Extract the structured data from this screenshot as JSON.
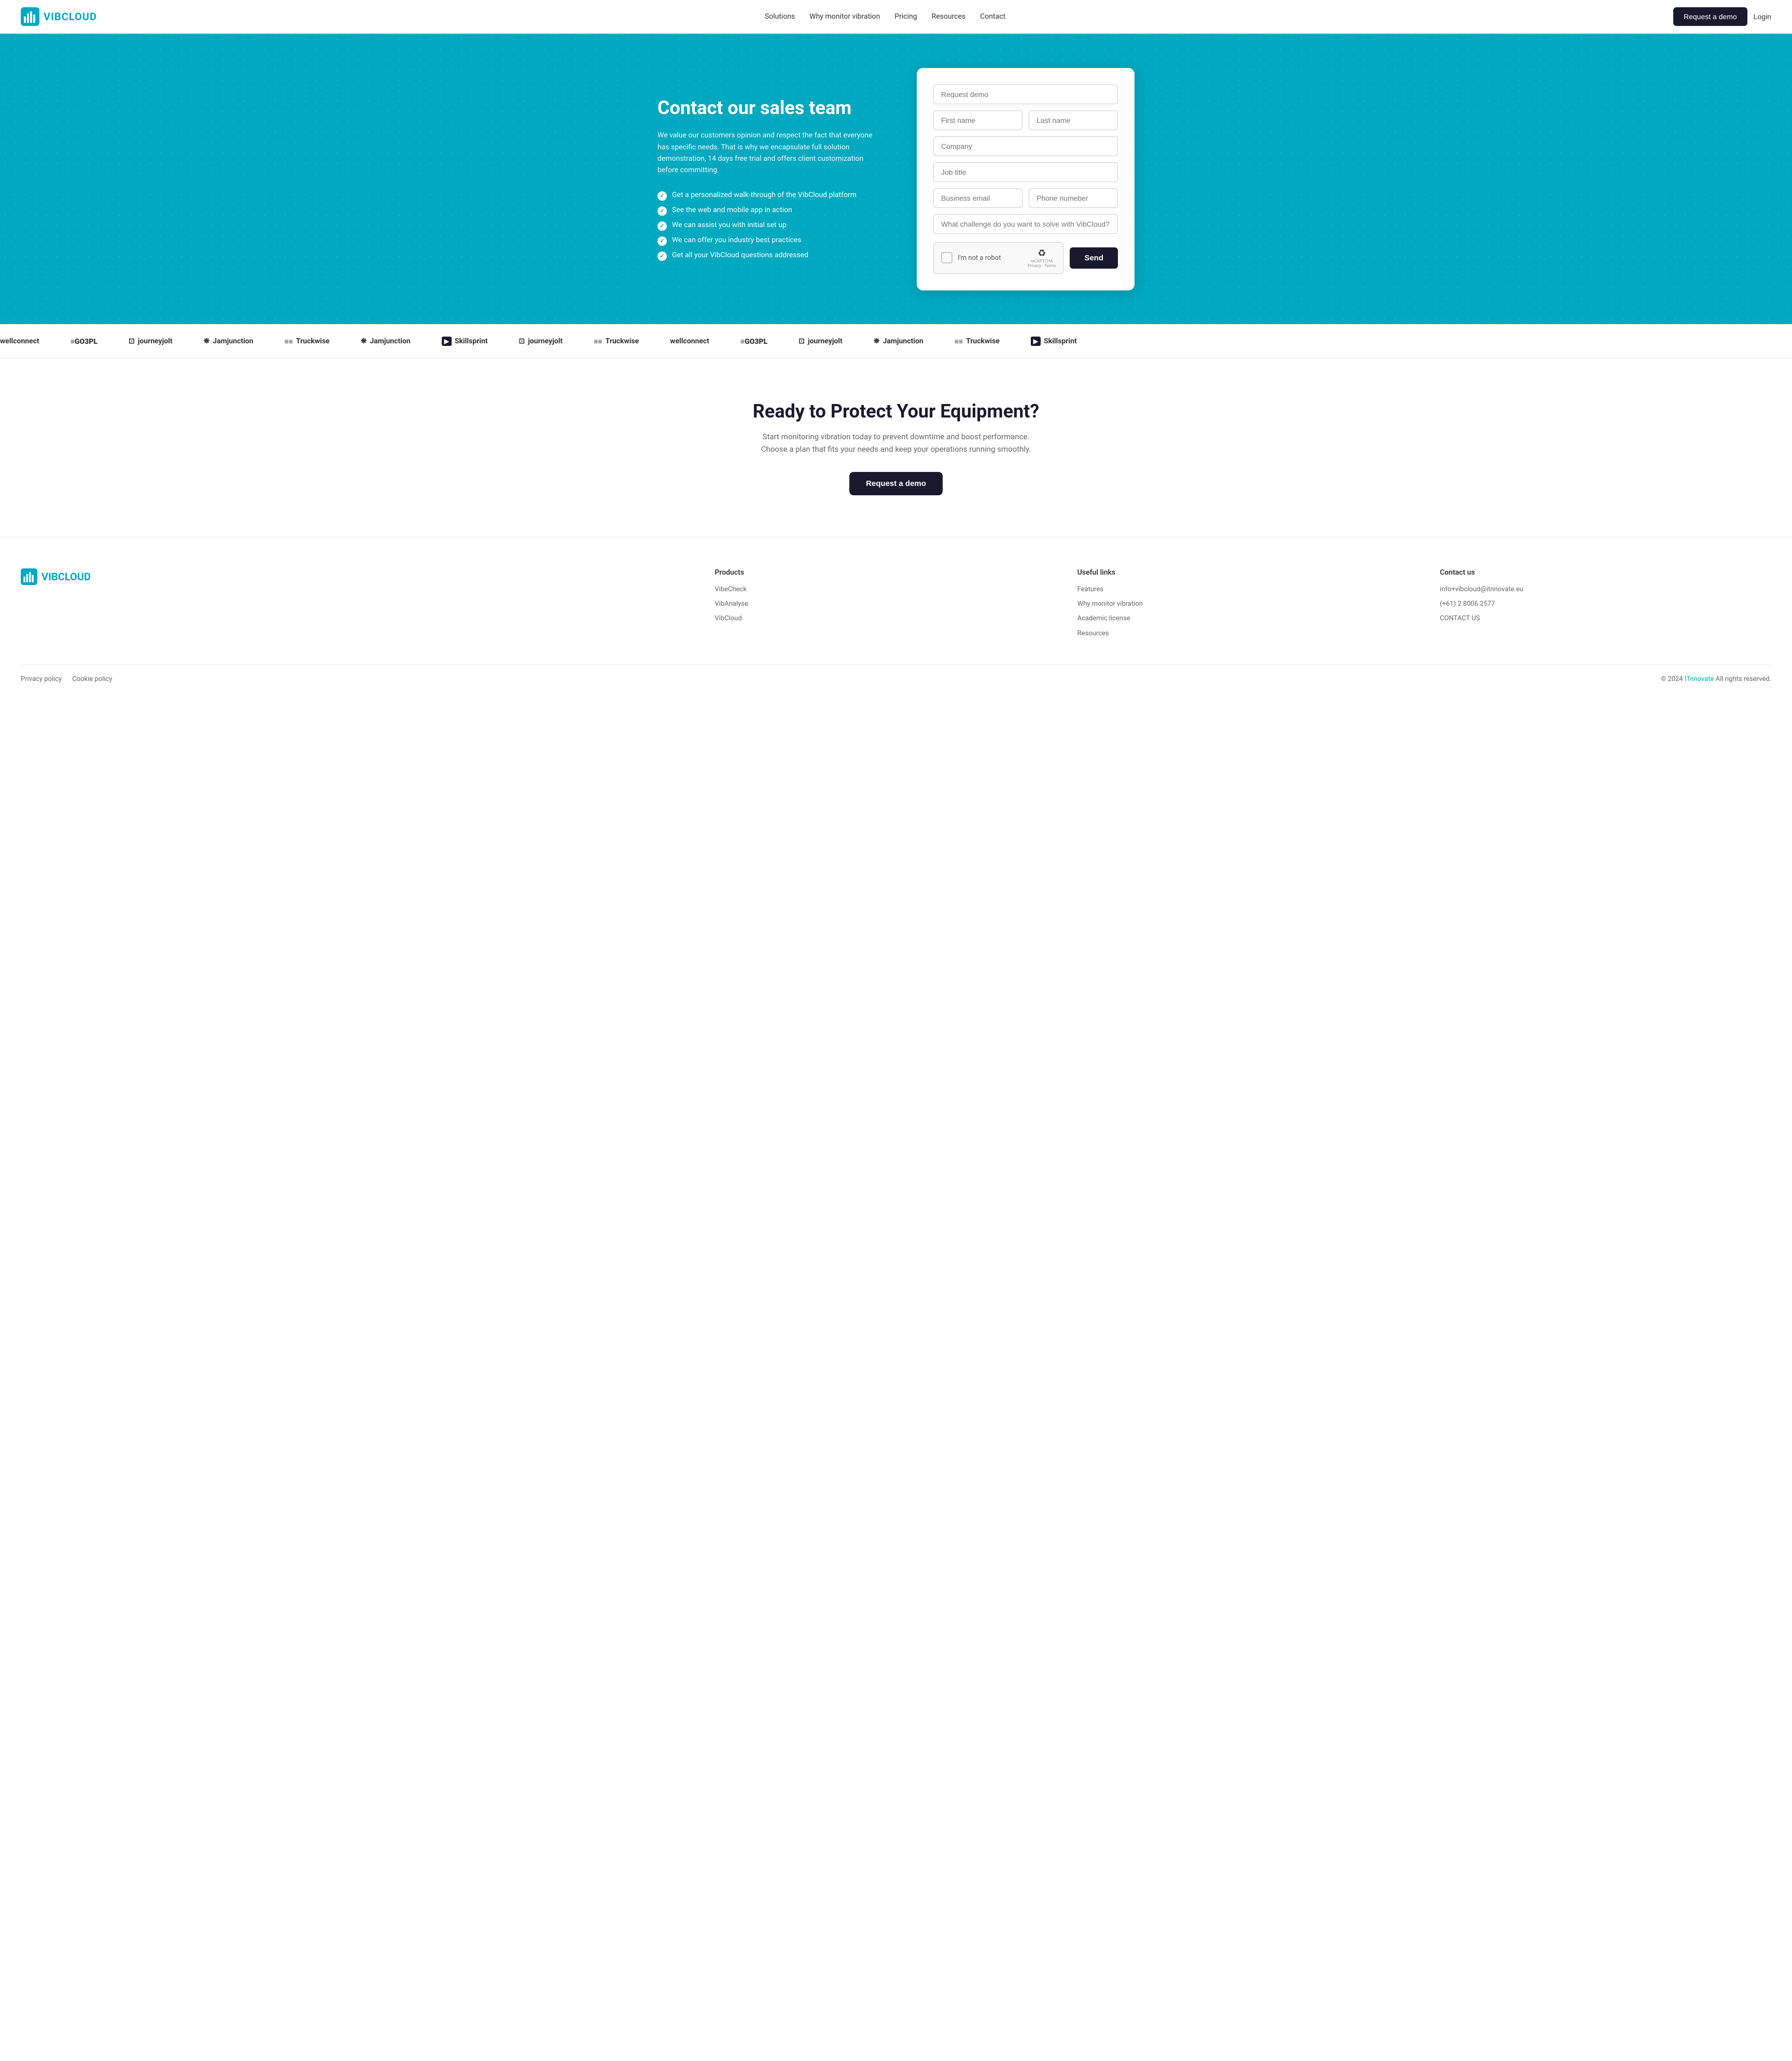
{
  "nav": {
    "logo_text_vib": "VIB",
    "logo_text_cloud": "CLOUD",
    "links": [
      {
        "label": "Solutions",
        "href": "#"
      },
      {
        "label": "Why monitor vibration",
        "href": "#"
      },
      {
        "label": "Pricing",
        "href": "#"
      },
      {
        "label": "Resources",
        "href": "#"
      },
      {
        "label": "Contact",
        "href": "#"
      }
    ],
    "btn_demo": "Request a demo",
    "btn_login": "Login"
  },
  "hero": {
    "heading": "Contact our sales team",
    "description": "We value our customers opinion and respect the fact that everyone has specific needs. That is why we encapsulate full solution demonstration, 14 days free trial and offers client customization before committing.",
    "checklist": [
      "Get a personalized walk-through of the VibCloud platform",
      "See the web and mobile app in action",
      "We can assist you with initial set up",
      "We can offer you industry best practices",
      "Get all your VibCloud questions addressed"
    ]
  },
  "form": {
    "placeholder_demo": "Request demo",
    "placeholder_first": "First name",
    "placeholder_last": "Last name",
    "placeholder_company": "Company",
    "placeholder_job": "Job title",
    "placeholder_email": "Business email",
    "placeholder_phone": "Phone numeber",
    "placeholder_challenge": "What challenge do you want to solve with VibCloud?",
    "recaptcha_label": "I'm not a robot",
    "recaptcha_brand": "reCAPTCHA",
    "recaptcha_privacy": "Privacy - Terms",
    "btn_send": "Send"
  },
  "logos": [
    {
      "name": "wellconnect",
      "symbol": ""
    },
    {
      "name": "=GO3PL",
      "symbol": "≡"
    },
    {
      "name": "journeyjolt",
      "symbol": "⊡"
    },
    {
      "name": "Jamjunction",
      "symbol": "❋"
    },
    {
      "name": "Truckwise",
      "symbol": "≡≡"
    },
    {
      "name": "Jamjunction",
      "symbol": "❋"
    },
    {
      "name": "Skillsprint",
      "symbol": "▶"
    },
    {
      "name": "journeyjolt",
      "symbol": "⊡"
    },
    {
      "name": "Truckwise",
      "symbol": "≡≡"
    },
    {
      "name": "wellconnect",
      "symbol": ""
    }
  ],
  "cta": {
    "heading": "Ready to Protect Your Equipment?",
    "description_line1": "Start monitoring vibration today to prevent downtime and boost performance.",
    "description_line2": "Choose a plan that fits your needs and keep your operations running smoothly.",
    "btn_label": "Request a demo"
  },
  "footer": {
    "logo_vib": "VIB",
    "logo_cloud": "CLOUD",
    "products_heading": "Products",
    "products_links": [
      "VibeCheck",
      "VibAnalyse",
      "VibCloud"
    ],
    "useful_heading": "Useful links",
    "useful_links": [
      "Features",
      "Why monitor vibration",
      "Academic license",
      "Resources"
    ],
    "contact_heading": "Contact us",
    "contact_email": "info+vibcloud@itnnovate.eu",
    "contact_phone": "(+61) 2 8006 2577",
    "contact_link": "CONTACT US",
    "privacy": "Privacy policy",
    "cookie": "Cookie policy",
    "copyright": "© 2024 ",
    "copyright_brand": "ITnnovate",
    "copyright_suffix": " All rights reserved."
  }
}
